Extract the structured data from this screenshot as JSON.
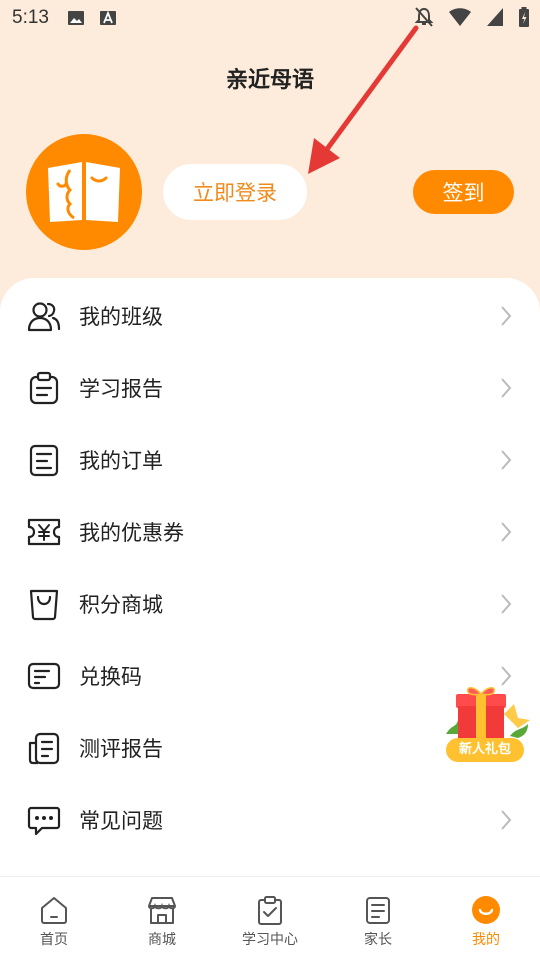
{
  "status_bar": {
    "time": "5:13"
  },
  "header": {
    "title": "亲近母语"
  },
  "profile": {
    "login_label": "立即登录",
    "signin_label": "签到"
  },
  "menu": [
    {
      "name": "my-class",
      "label": "我的班级",
      "icon": "users-icon",
      "chevron": true
    },
    {
      "name": "study-report",
      "label": "学习报告",
      "icon": "clipboard-icon",
      "chevron": true
    },
    {
      "name": "my-orders",
      "label": "我的订单",
      "icon": "document-icon",
      "chevron": true
    },
    {
      "name": "my-coupons",
      "label": "我的优惠券",
      "icon": "coupon-icon",
      "chevron": true
    },
    {
      "name": "points-mall",
      "label": "积分商城",
      "icon": "bag-icon",
      "chevron": true
    },
    {
      "name": "redeem-code",
      "label": "兑换码",
      "icon": "code-icon",
      "chevron": true
    },
    {
      "name": "assessment-report",
      "label": "测评报告",
      "icon": "report-icon",
      "chevron": false
    },
    {
      "name": "faq",
      "label": "常见问题",
      "icon": "chat-icon",
      "chevron": true
    }
  ],
  "gift": {
    "label": "新人礼包"
  },
  "tabs": [
    {
      "label": "首页",
      "icon": "home-icon",
      "active": false
    },
    {
      "label": "商城",
      "icon": "store-icon",
      "active": false
    },
    {
      "label": "学习中心",
      "icon": "study-icon",
      "active": false
    },
    {
      "label": "家长",
      "icon": "book-icon",
      "active": false
    },
    {
      "label": "我的",
      "icon": "smile-icon",
      "active": true
    }
  ],
  "colors": {
    "accent": "#ff8a00",
    "background": "#fdecdb",
    "arrow": "#e53935"
  }
}
